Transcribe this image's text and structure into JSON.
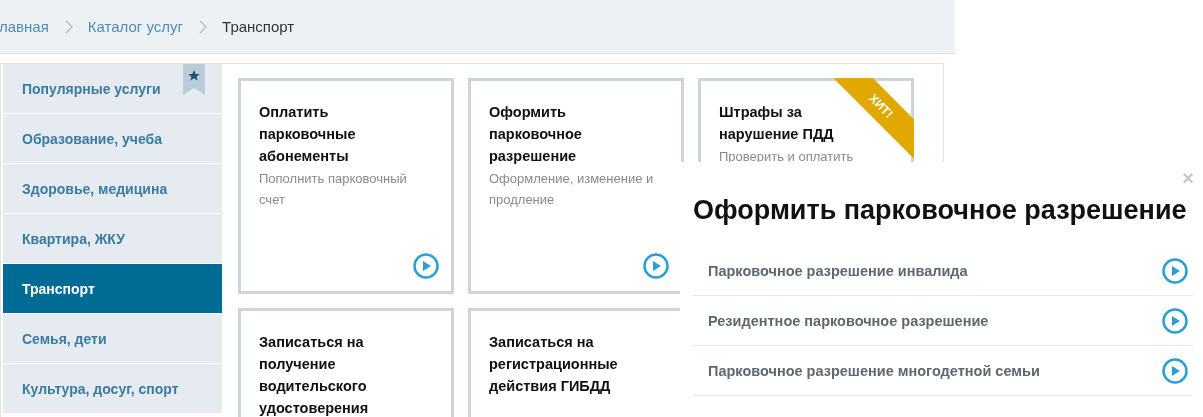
{
  "breadcrumbs": [
    {
      "label": "лавная",
      "current": false
    },
    {
      "label": "Каталог услуг",
      "current": false
    },
    {
      "label": "Транспорт",
      "current": true
    }
  ],
  "sidebar": {
    "items": [
      {
        "label": "Популярные услуги",
        "selected": false,
        "bookmarked": true
      },
      {
        "label": "Образование, учеба",
        "selected": false,
        "bookmarked": false
      },
      {
        "label": "Здоровье, медицина",
        "selected": false,
        "bookmarked": false
      },
      {
        "label": "Квартира, ЖКУ",
        "selected": false,
        "bookmarked": false
      },
      {
        "label": "Транспорт",
        "selected": true,
        "bookmarked": false
      },
      {
        "label": "Семья, дети",
        "selected": false,
        "bookmarked": false
      },
      {
        "label": "Культура, досуг, спорт",
        "selected": false,
        "bookmarked": false
      }
    ]
  },
  "cards": [
    {
      "title": "Оплатить парковочные абонементы",
      "description": "Пополнить парковочный счет"
    },
    {
      "title": "Оформить парковочное разрешение",
      "description": "Оформление, изменение и продление"
    },
    {
      "title": "Штрафы за нарушение ПДД",
      "description": "Проверить и оплатить",
      "badge": "ХИТ!"
    },
    {
      "title": "Записаться на получение водительского удостоверения"
    },
    {
      "title": "Записаться на регистрационные действия ГИБДД"
    }
  ],
  "popup": {
    "close": "×",
    "title": "Оформить парковочное разрешение",
    "items": [
      "Парковочное разрешение инвалида",
      "Резидентное парковочное разрешение",
      "Парковочное разрешение многодетной семьи"
    ]
  }
}
